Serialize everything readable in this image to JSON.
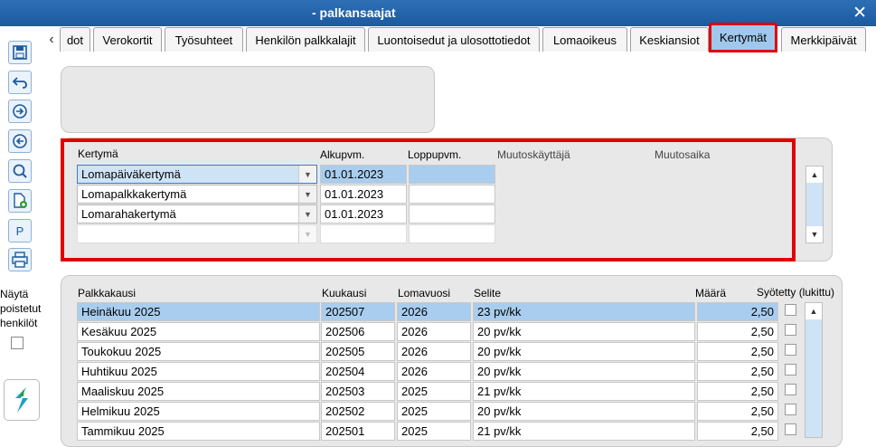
{
  "window": {
    "title": "- palkansaajat",
    "close_icon": "close-icon"
  },
  "tabs": [
    "dot",
    "Verokortit",
    "Työsuhteet",
    "Henkilön palkkalajit",
    "Luontoisedut ja ulosottotiedot",
    "Lomaoikeus",
    "Keskiansiot",
    "Kertymät",
    "Merkkipäivät"
  ],
  "active_tab": "Kertymät",
  "sidebar": {
    "p_label": "P",
    "show_deleted_label_1": "Näytä",
    "show_deleted_label_2": "poistetut",
    "show_deleted_label_3": "henkilöt"
  },
  "kertyma": {
    "headers": {
      "kertyma": "Kertymä",
      "alkupvm": "Alkupvm.",
      "loppupvm": "Loppupvm.",
      "muutoskayttaja": "Muutoskäyttäjä",
      "muutosaika": "Muutosaika"
    },
    "rows": [
      {
        "name": "Lomapäiväkertymä",
        "alkupvm": "01.01.2023",
        "loppupvm": ""
      },
      {
        "name": "Lomapalkkakertymä",
        "alkupvm": "01.01.2023",
        "loppupvm": ""
      },
      {
        "name": "Lomarahakertymä",
        "alkupvm": "01.01.2023",
        "loppupvm": ""
      },
      {
        "name": "",
        "alkupvm": "",
        "loppupvm": ""
      }
    ]
  },
  "palkka": {
    "headers": {
      "palkkakausi": "Palkkakausi",
      "kuukausi": "Kuukausi",
      "lomavuosi": "Lomavuosi",
      "selite": "Selite",
      "maara": "Määrä",
      "syotetty": "Syötetty (lukittu)"
    },
    "rows": [
      {
        "palkkakausi": "Heinäkuu 2025",
        "kuukausi": "202507",
        "lomavuosi": "2026",
        "selite": "23 pv/kk",
        "maara": "2,50"
      },
      {
        "palkkakausi": "Kesäkuu 2025",
        "kuukausi": "202506",
        "lomavuosi": "2026",
        "selite": "20 pv/kk",
        "maara": "2,50"
      },
      {
        "palkkakausi": "Toukokuu 2025",
        "kuukausi": "202505",
        "lomavuosi": "2026",
        "selite": "20 pv/kk",
        "maara": "2,50"
      },
      {
        "palkkakausi": "Huhtikuu 2025",
        "kuukausi": "202504",
        "lomavuosi": "2026",
        "selite": "20 pv/kk",
        "maara": "2,50"
      },
      {
        "palkkakausi": "Maaliskuu 2025",
        "kuukausi": "202503",
        "lomavuosi": "2025",
        "selite": "21 pv/kk",
        "maara": "2,50"
      },
      {
        "palkkakausi": "Helmikuu 2025",
        "kuukausi": "202502",
        "lomavuosi": "2025",
        "selite": "20 pv/kk",
        "maara": "2,50"
      },
      {
        "palkkakausi": "Tammikuu 2025",
        "kuukausi": "202501",
        "lomavuosi": "2025",
        "selite": "21 pv/kk",
        "maara": "2,50"
      }
    ]
  },
  "colors": {
    "titlebar": "#1d5aa0",
    "selection": "#a9cdee",
    "highlight": "#e00000"
  }
}
